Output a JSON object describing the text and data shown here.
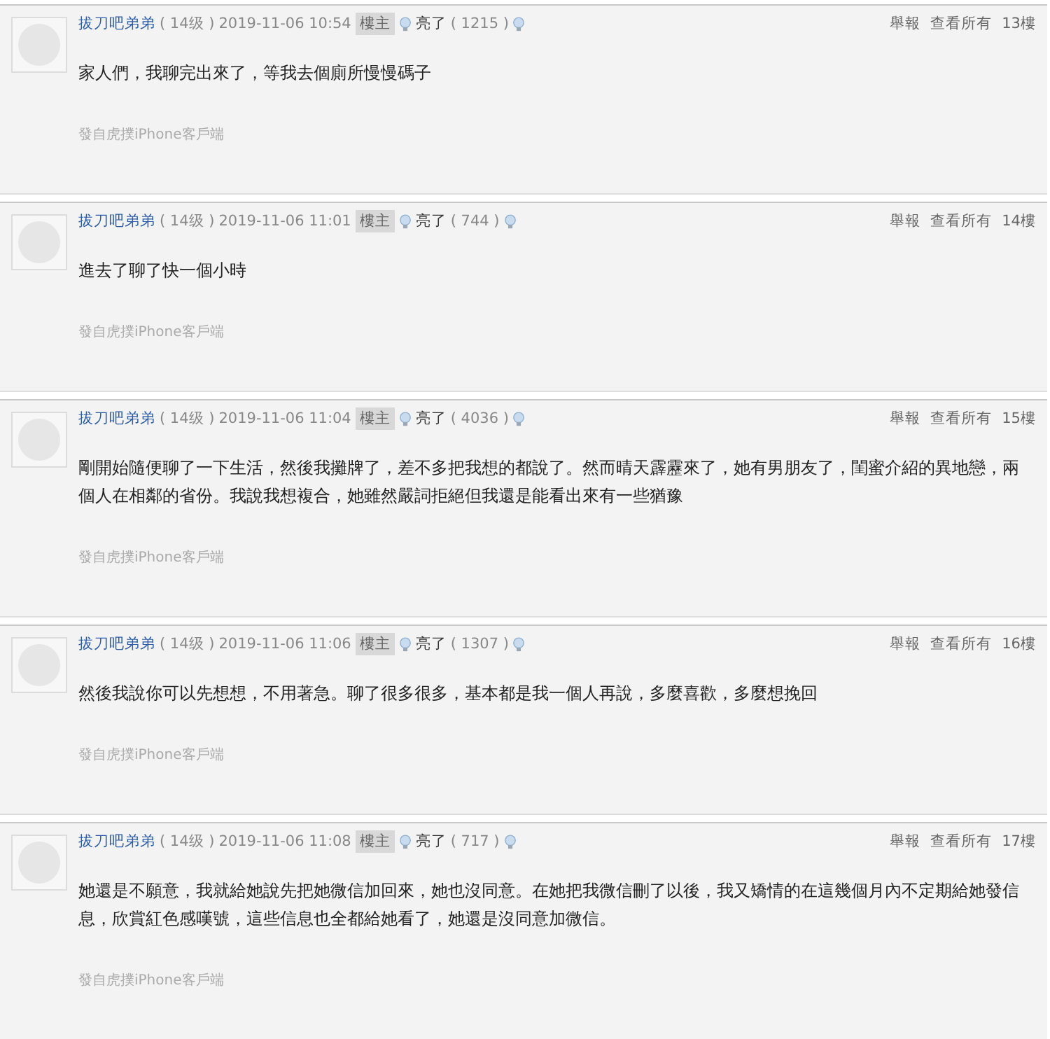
{
  "posts": [
    {
      "username": "拔刀吧弟弟",
      "level": "( 14级 )",
      "datetime": "2019-11-06 10:54",
      "badge": "樓主",
      "liked_label": "亮了",
      "like_count": "( 1215 )",
      "report": "舉報",
      "view_all": "查看所有",
      "floor": "13樓",
      "content": "家人們，我聊完出來了，等我去個廁所慢慢碼子",
      "source": "發自虎撲iPhone客戶端"
    },
    {
      "username": "拔刀吧弟弟",
      "level": "( 14级 )",
      "datetime": "2019-11-06 11:01",
      "badge": "樓主",
      "liked_label": "亮了",
      "like_count": "( 744 )",
      "report": "舉報",
      "view_all": "查看所有",
      "floor": "14樓",
      "content": "進去了聊了快一個小時",
      "source": "發自虎撲iPhone客戶端"
    },
    {
      "username": "拔刀吧弟弟",
      "level": "( 14级 )",
      "datetime": "2019-11-06 11:04",
      "badge": "樓主",
      "liked_label": "亮了",
      "like_count": "( 4036 )",
      "report": "舉報",
      "view_all": "查看所有",
      "floor": "15樓",
      "content": "剛開始隨便聊了一下生活，然後我攤牌了，差不多把我想的都說了。然而晴天霹靂來了，她有男朋友了，閨蜜介紹的異地戀，兩個人在相鄰的省份。我說我想複合，她雖然嚴詞拒絕但我還是能看出來有一些猶豫",
      "source": "發自虎撲iPhone客戶端"
    },
    {
      "username": "拔刀吧弟弟",
      "level": "( 14级 )",
      "datetime": "2019-11-06 11:06",
      "badge": "樓主",
      "liked_label": "亮了",
      "like_count": "( 1307 )",
      "report": "舉報",
      "view_all": "查看所有",
      "floor": "16樓",
      "content": "然後我說你可以先想想，不用著急。聊了很多很多，基本都是我一個人再說，多麼喜歡，多麼想挽回",
      "source": "發自虎撲iPhone客戶端"
    },
    {
      "username": "拔刀吧弟弟",
      "level": "( 14级 )",
      "datetime": "2019-11-06 11:08",
      "badge": "樓主",
      "liked_label": "亮了",
      "like_count": "( 717 )",
      "report": "舉報",
      "view_all": "查看所有",
      "floor": "17樓",
      "content": "她還是不願意，我就給她說先把她微信加回來，她也沒同意。在她把我微信刪了以後，我又矯情的在這幾個月內不定期給她發信息，欣賞紅色感嘆號，這些信息也全都給她看了，她還是沒同意加微信。",
      "source": "發自虎撲iPhone客戶端"
    }
  ]
}
